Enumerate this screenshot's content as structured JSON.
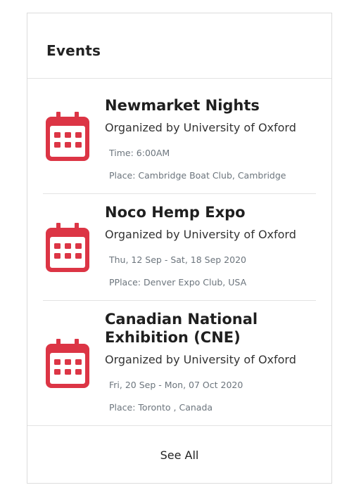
{
  "widget": {
    "title": "Events",
    "footer_link": "See All",
    "icon_color": "#dc3545"
  },
  "events": [
    {
      "icon": "calendar-icon",
      "name": "Newmarket Nights",
      "organizer": "Organized by University of Oxford",
      "line1": "Time: 6:00AM",
      "line2": "Place: Cambridge Boat Club, Cambridge"
    },
    {
      "icon": "calendar-icon",
      "name": "Noco Hemp Expo",
      "organizer": "Organized by University of Oxford",
      "line1": "Thu, 12 Sep - Sat, 18 Sep 2020",
      "line2": "PPlace: Denver Expo Club, USA"
    },
    {
      "icon": "calendar-icon",
      "name": "Canadian National Exhibition (CNE)",
      "organizer": "Organized by University of Oxford",
      "line1": "Fri, 20 Sep - Mon, 07 Oct 2020",
      "line2": "Place: Toronto , Canada"
    }
  ]
}
